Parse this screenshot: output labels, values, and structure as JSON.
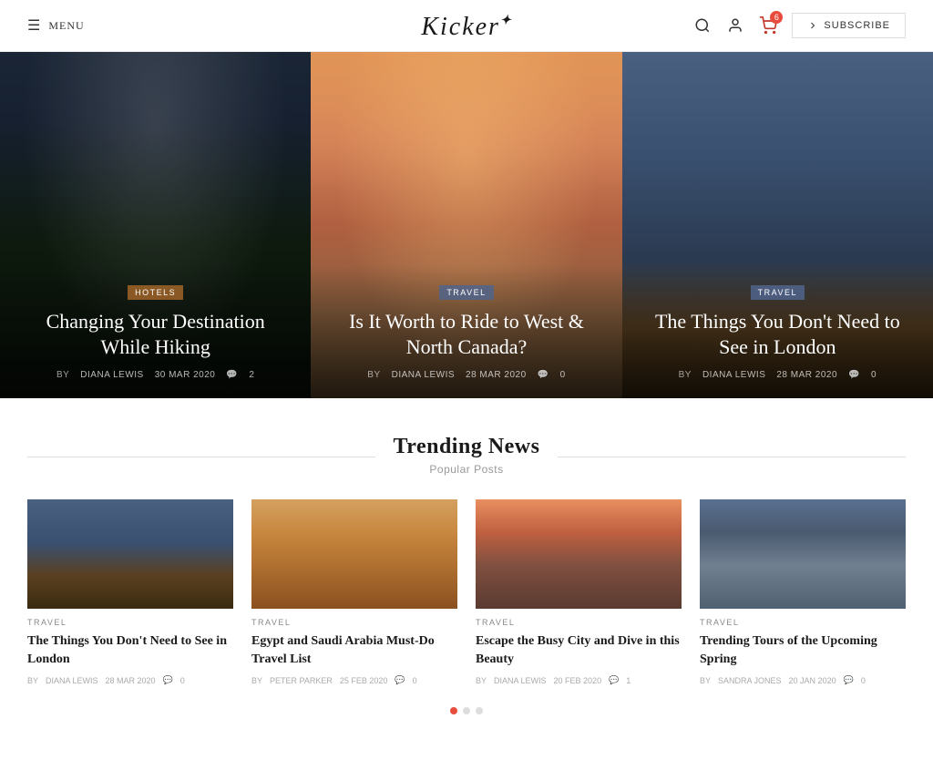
{
  "header": {
    "menu_label": "MENU",
    "logo": "Kicker",
    "subscribe_label": "SUBSCRIBE",
    "cart_count": "6"
  },
  "hero_cards": [
    {
      "category": "HOTELS",
      "category_type": "hotels",
      "title": "Changing Your Destination While Hiking",
      "author": "DIANA LEWIS",
      "date": "30 MAR 2020",
      "comments": "2"
    },
    {
      "category": "TRAVEL",
      "category_type": "travel",
      "title": "Is It Worth to Ride to West & North Canada?",
      "author": "DIANA LEWIS",
      "date": "28 MAR 2020",
      "comments": "0"
    },
    {
      "category": "TRAVEL",
      "category_type": "travel",
      "title": "The Things You Don't Need to See in London",
      "author": "DIANA LEWIS",
      "date": "28 MAR 2020",
      "comments": "0"
    }
  ],
  "trending": {
    "title": "Trending News",
    "subtitle": "Popular Posts",
    "cards": [
      {
        "category": "TRAVEL",
        "title": "The Things You Don't Need to See in London",
        "author": "DIANA LEWIS",
        "date": "28 MAR 2020",
        "comments": "0"
      },
      {
        "category": "TRAVEL",
        "title": "Egypt and Saudi Arabia Must-Do Travel List",
        "author": "PETER PARKER",
        "date": "25 FEB 2020",
        "comments": "0"
      },
      {
        "category": "TRAVEL",
        "title": "Escape the Busy City and Dive in this Beauty",
        "author": "DIANA LEWIS",
        "date": "20 FEB 2020",
        "comments": "1"
      },
      {
        "category": "TRAVEL",
        "title": "Trending Tours of the Upcoming Spring",
        "author": "SANDRA JONES",
        "date": "20 JAN 2020",
        "comments": "0"
      }
    ]
  },
  "pagination": {
    "active_dot": 0,
    "total_dots": 3
  }
}
